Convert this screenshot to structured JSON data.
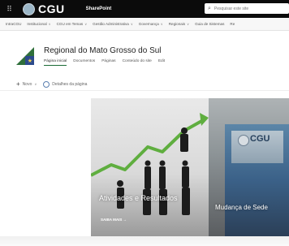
{
  "suite": {
    "brand": "CGU",
    "app": "SharePoint",
    "search_placeholder": "Pesquisar este site"
  },
  "hubnav": {
    "items": [
      {
        "label": "IntraCGU",
        "has_chevron": false
      },
      {
        "label": "Institucional",
        "has_chevron": true
      },
      {
        "label": "CGU em Temas",
        "has_chevron": true
      },
      {
        "label": "Gestão Administrativa",
        "has_chevron": true
      },
      {
        "label": "Governança",
        "has_chevron": true
      },
      {
        "label": "Regionais",
        "has_chevron": true
      },
      {
        "label": "Guia de Sistemas",
        "has_chevron": false
      },
      {
        "label": "Re",
        "has_chevron": false
      }
    ]
  },
  "site": {
    "title": "Regional do Mato Grosso do Sul",
    "tabs": [
      "Página inicial",
      "Documentos",
      "Páginas",
      "Conteúdo do site",
      "Edit"
    ],
    "active_tab": "Página inicial"
  },
  "commandbar": {
    "new_label": "Novo",
    "details_label": "Detalhes da página"
  },
  "hero": {
    "left": {
      "title": "Atividades e Resultados",
      "link": "SAIBA MAIS →"
    },
    "right": {
      "title": "Mudança de Sede",
      "sign_text": "CGU"
    }
  },
  "colors": {
    "suitebar": "#0b0b0b",
    "accent_green": "#1a6b35",
    "chart_arrow": "#5fae3f"
  }
}
